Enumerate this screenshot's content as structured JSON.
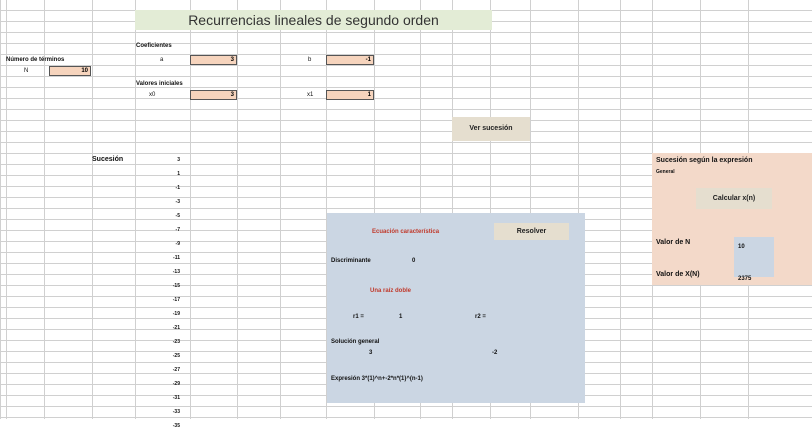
{
  "title": "Recurrencias lineales de segundo orden",
  "coef_label": "Coeficientes",
  "coef_a_label": "a",
  "coef_a_value": "3",
  "coef_b_label": "b",
  "coef_b_value": "-1",
  "num_terms_label": "Número de términos",
  "n_label": "N",
  "n_value": "10",
  "initial_label": "Valores iniciales",
  "x0_label": "x0",
  "x0_value": "3",
  "x1_label": "x1",
  "x1_value": "1",
  "ver_button": "Ver sucesión",
  "sequence_label": "Sucesión",
  "sequence": [
    "3",
    "1",
    "-1",
    "-3",
    "-5",
    "-7",
    "-9",
    "-11",
    "-13",
    "-15",
    "-17",
    "-19",
    "-21",
    "-23",
    "-25",
    "-27",
    "-29",
    "-31",
    "-33",
    "-35"
  ],
  "char": {
    "title": "Ecuación característica",
    "resolver_button": "Resolver",
    "discriminant_label": "Discriminante",
    "discriminant_value": "0",
    "double_root": "Una raíz doble",
    "r1_label": "r1 =",
    "r1_value": "1",
    "r2_label": "r2 =",
    "general_label": "Solución general",
    "general_val1": "3",
    "general_val2": "-2",
    "expression": "Expresión 3*(1)^n+-2*n*(1)^(n-1)"
  },
  "right": {
    "title": "Sucesión según la expresión",
    "subtitle": "General",
    "calc_button": "Calcular x(n)",
    "n_label": "Valor de N",
    "n_value": "10",
    "x_label": "Valor de X(N)",
    "x_value": "2375"
  },
  "colors": {
    "title_bg": "#e3ecd6",
    "input_bg": "#f6d4bd",
    "panel_blue": "#cbd6e3",
    "panel_peach": "#f3d9c9",
    "button_bg": "#e5decf",
    "red_text": "#c0392b",
    "grid": "#d0d0d0"
  }
}
